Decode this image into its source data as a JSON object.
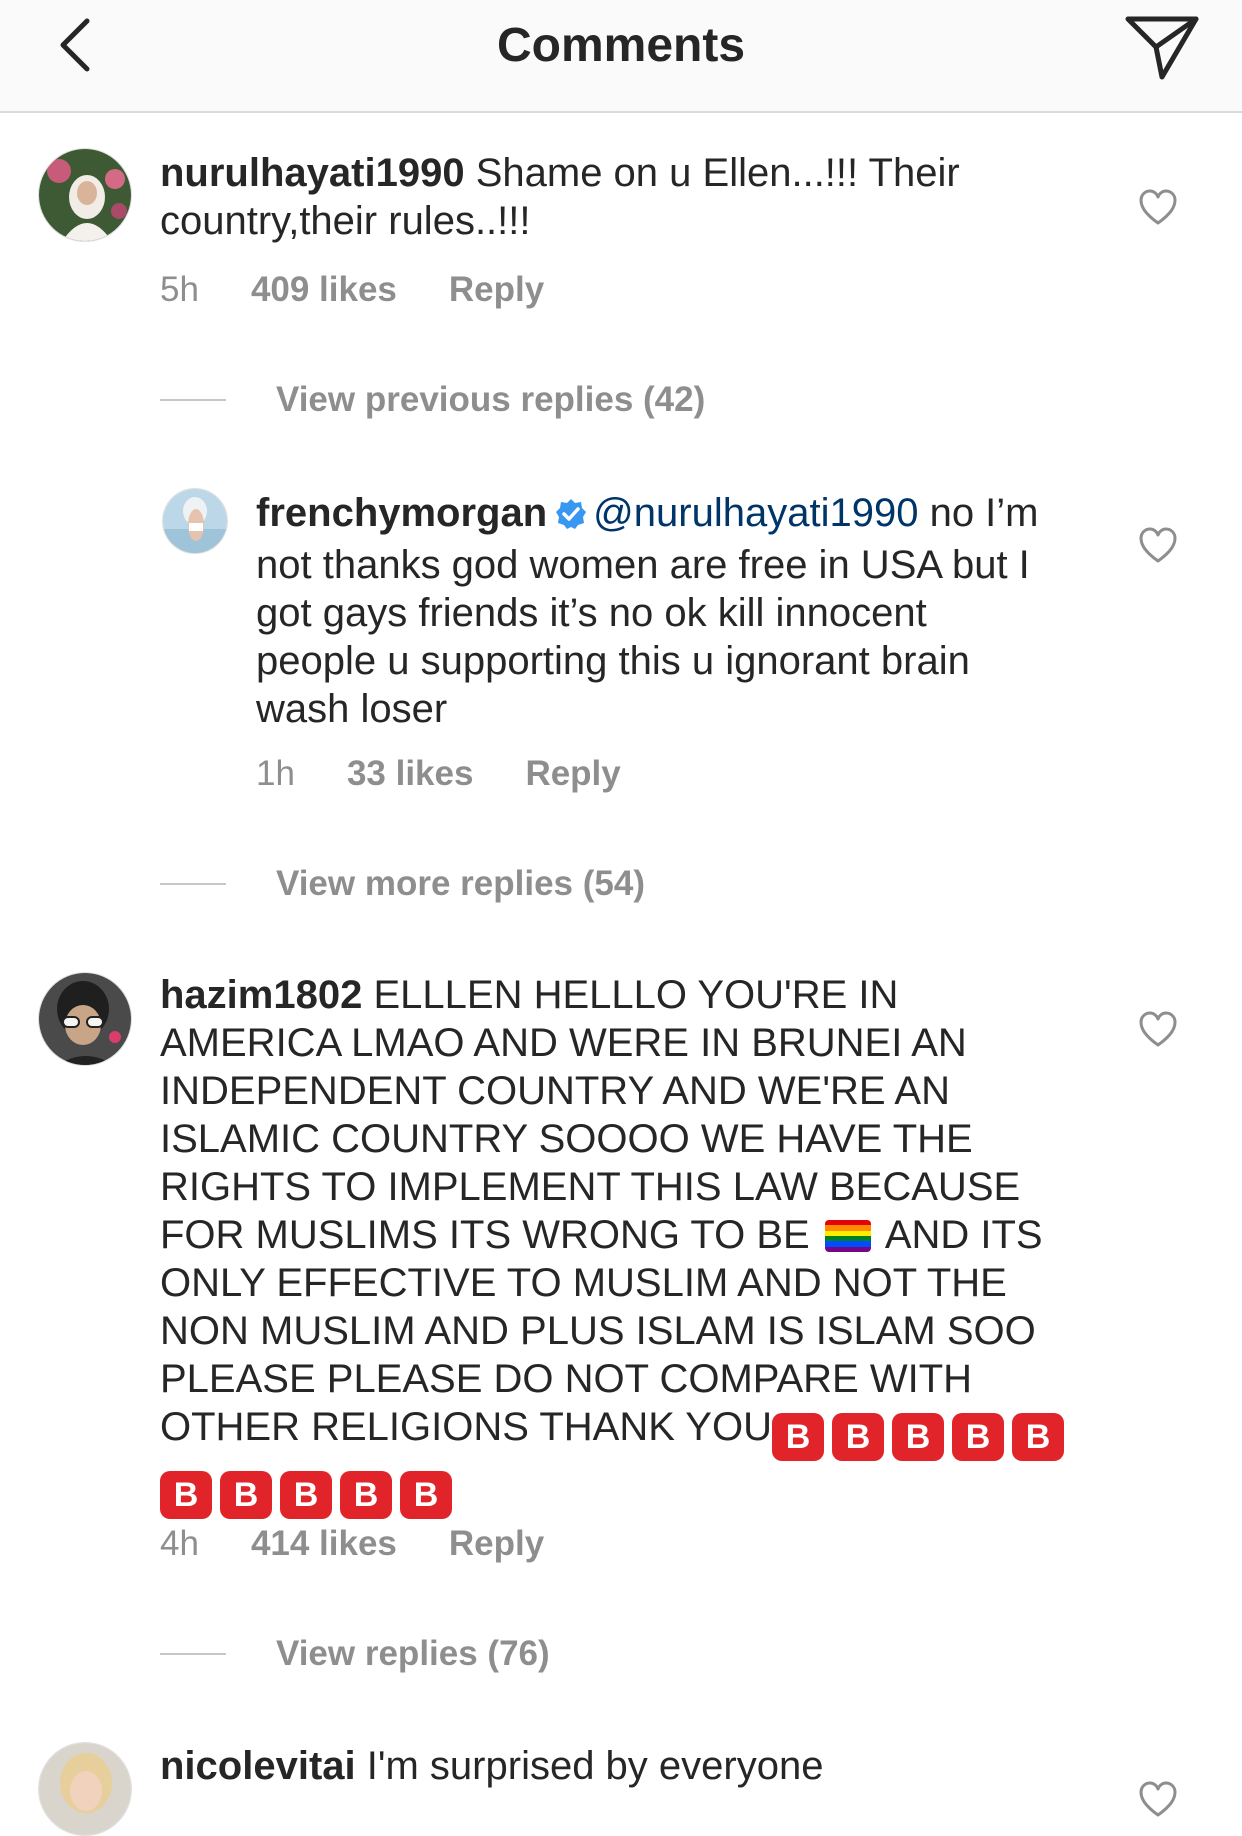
{
  "header": {
    "title": "Comments"
  },
  "comments": [
    {
      "username": "nurulhayati1990",
      "text": "Shame on u Ellen...!!! Their country,their rules..!!!",
      "time": "5h",
      "likes": "409 likes",
      "reply": "Reply",
      "view_replies": "View previous replies (42)",
      "reply_item": {
        "username": "frenchymorgan",
        "mention": "@nurulhayati1990",
        "text": "no I’m not thanks god women  are free in USA but I got gays friends it’s no ok kill innocent people u supporting this u ignorant brain wash loser",
        "time": "1h",
        "likes": "33 likes",
        "reply": "Reply"
      },
      "view_more": "View more replies (54)"
    },
    {
      "username": "hazim1802",
      "text_part1": "ELLLEN HELLLO YOU'RE IN AMERICA LMAO AND WERE IN BRUNEI AN INDEPENDENT COUNTRY AND WE'RE AN ISLAMIC COUNTRY SOOOO WE HAVE THE RIGHTS TO IMPLEMENT THIS LAW BECAUSE FOR MUSLIMS ITS WRONG TO BE",
      "text_part2": "AND ITS ONLY EFFECTIVE TO MUSLIM AND NOT THE NON MUSLIM AND PLUS ISLAM IS ISLAM SOO PLEASE PLEASE DO NOT COMPARE WITH OTHER RELIGIONS THANK YOU",
      "b_emoji": "B",
      "time": "4h",
      "likes": "414 likes",
      "reply": "Reply",
      "view_replies": "View replies (76)"
    },
    {
      "username": "nicolevitai",
      "text": "I'm surprised by everyone"
    }
  ],
  "icons": {
    "back": "chevron-left-icon",
    "share": "paper-plane-icon",
    "like": "heart-outline-icon",
    "verified": "verified-badge-icon",
    "flag": "rainbow-flag-emoji",
    "b_button": "b-button-emoji"
  },
  "colors": {
    "text": "#262626",
    "muted": "#8e8e8e",
    "mention": "#003569",
    "verified": "#3897f0",
    "b_button": "#e0242a",
    "header_bg": "#fafafa"
  }
}
